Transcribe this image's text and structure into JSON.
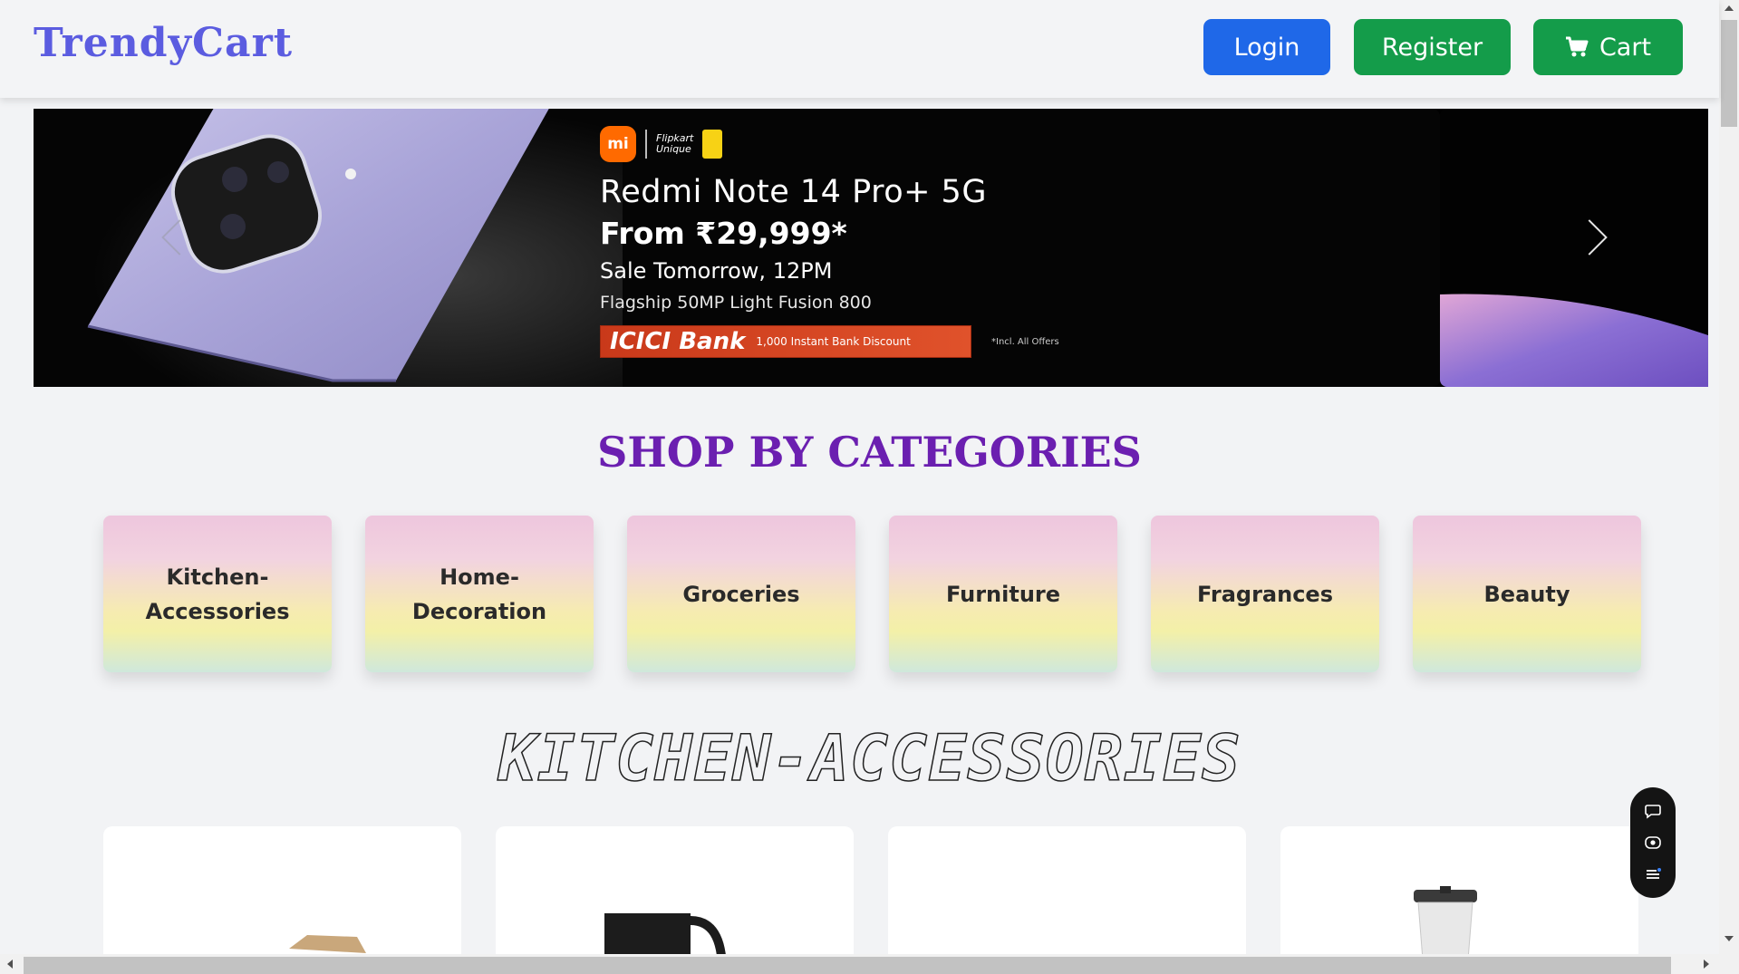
{
  "header": {
    "logo": "TrendyCart",
    "login_label": "Login",
    "register_label": "Register",
    "cart_label": "Cart",
    "cart_icon": "shopping-cart-icon"
  },
  "banner": {
    "brand_logo": "mi",
    "partner_line1": "Flipkart",
    "partner_line2": "Unique",
    "product_name": "Redmi Note 14 Pro+ 5G",
    "price": "From ₹29,999*",
    "sale": "Sale Tomorrow, 12PM",
    "feature": "Flagship 50MP Light Fusion 800",
    "bank_name": "ICICI Bank",
    "bank_offer": "1,000 Instant Bank Discount",
    "disclaimer": "*Incl. All Offers"
  },
  "categories_title": "SHOP BY CATEGORIES",
  "categories": [
    {
      "label": "Kitchen-Accessories"
    },
    {
      "label": "Home-Decoration"
    },
    {
      "label": "Groceries"
    },
    {
      "label": "Furniture"
    },
    {
      "label": "Fragrances"
    },
    {
      "label": "Beauty"
    }
  ],
  "section_title": "KITCHEN-ACCESSORIES",
  "colors": {
    "primary": "#1f68e8",
    "success": "#149c4a",
    "logo": "#5b5ce0",
    "heading": "#6b1fb0"
  }
}
